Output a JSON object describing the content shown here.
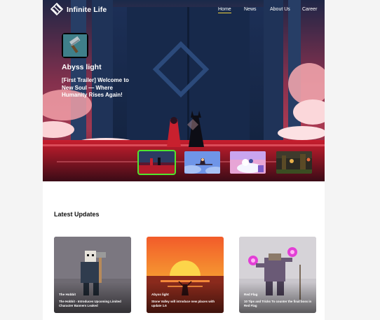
{
  "brand": {
    "name": "Infinite Life"
  },
  "nav": {
    "items": [
      "Home",
      "News",
      "About Us",
      "Career"
    ],
    "active": "Home",
    "active_color": "#f2d33c"
  },
  "hero": {
    "game_icon": "hammer-icon",
    "game_title": "Abyss light",
    "description": "[First Trailer] Welcome to New Soul — Where Humanity Rises Again!",
    "thumbnails": [
      "abyss-light-thumb",
      "witch-flying-thumb",
      "pink-pastel-thumb",
      "forest-night-thumb"
    ],
    "selected_thumb_color": "#4fe62e"
  },
  "latest": {
    "title": "Latest Updates",
    "cards": [
      {
        "tag": "The Hobbit",
        "text": "The Hobbit - Introduces Upcoming Limited Character Banners Leaked"
      },
      {
        "tag": "Abyss light",
        "text": "Stone Valley will introduce new places with update 1.6"
      },
      {
        "tag": "Red Flag",
        "text": "10 Tips and Tricks To counter the final boss in Red Flag"
      }
    ]
  }
}
